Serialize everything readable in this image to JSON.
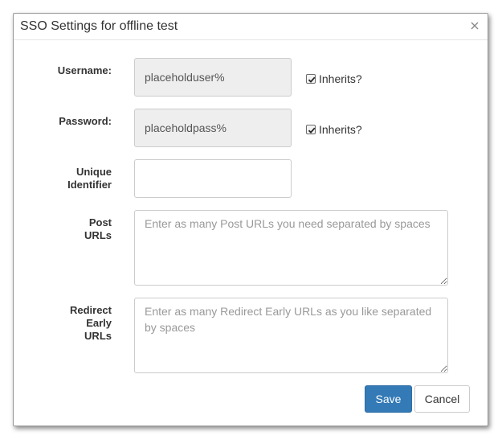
{
  "dialog": {
    "title": "SSO Settings for offline test",
    "close_icon": "close-icon"
  },
  "form": {
    "username": {
      "label": "Username:",
      "value": "placeholduser%",
      "inherits_label": "Inherits?",
      "inherits_checked": true
    },
    "password": {
      "label": "Password:",
      "value": "placeholdpass%",
      "inherits_label": "Inherits?",
      "inherits_checked": true
    },
    "unique_identifier": {
      "label_line1": "Unique",
      "label_line2": "Identifier",
      "value": ""
    },
    "post_urls": {
      "label_line1": "Post",
      "label_line2": "URLs",
      "placeholder": "Enter as many Post URLs you need separated by spaces"
    },
    "redirect_early_urls": {
      "label_line1": "Redirect",
      "label_line2": "Early",
      "label_line3": "URLs",
      "placeholder": "Enter as many Redirect Early URLs as you like separated by spaces"
    }
  },
  "footer": {
    "save_label": "Save",
    "cancel_label": "Cancel"
  },
  "colors": {
    "primary": "#337ab7",
    "disabled_input": "#eeeeee"
  }
}
